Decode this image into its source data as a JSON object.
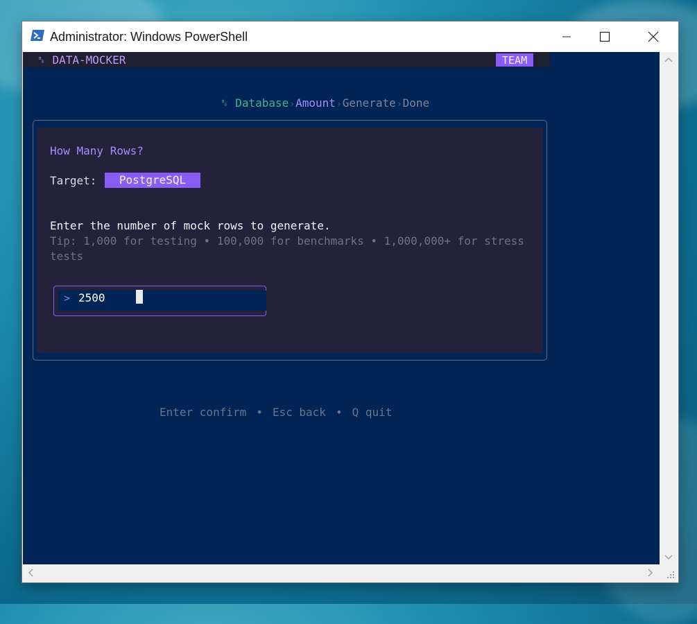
{
  "window": {
    "title": "Administrator: Windows PowerShell"
  },
  "app": {
    "brand_icon": "␈",
    "brand": "DATA-MOCKER",
    "badge": "TEAM"
  },
  "steps": [
    {
      "label": "␈ Database",
      "state": "done"
    },
    {
      "label": "Amount",
      "state": "active"
    },
    {
      "label": "Generate",
      "state": "todo"
    },
    {
      "label": "Done",
      "state": "todo"
    }
  ],
  "step_separator": "›",
  "panel": {
    "title": "How Many Rows?",
    "target_label": "Target:",
    "target_value": "PostgreSQL",
    "instruction": "Enter the number of mock rows to generate.",
    "tip": "Tip: 1,000 for testing  •  100,000 for benchmarks  •  1,000,000+ for stress tests",
    "input_prompt": ">",
    "input_value": "2500"
  },
  "hints": {
    "confirm": "Enter confirm",
    "back": "Esc back",
    "quit": "Q quit",
    "separator": "•"
  },
  "colors": {
    "console_bg": "#012456",
    "accent": "#8a5cf6",
    "done_step": "#3fb58e",
    "muted": "#6b7388"
  }
}
